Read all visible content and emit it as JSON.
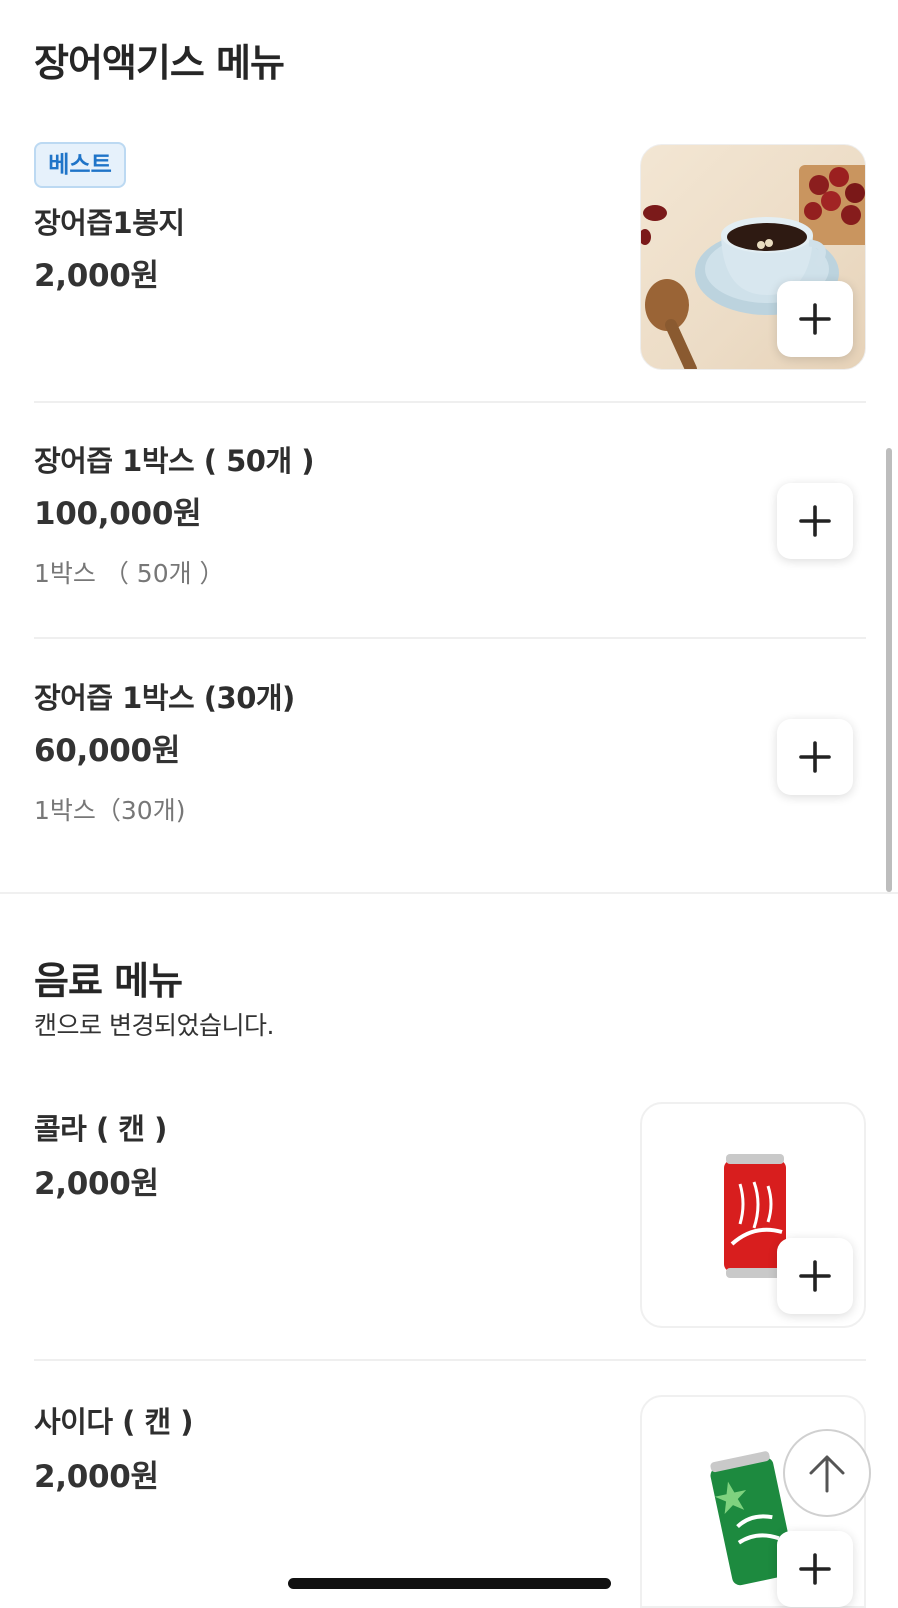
{
  "sections": {
    "extract": {
      "title": "장어액기스 메뉴",
      "items": [
        {
          "badge": "베스트",
          "name": "장어즙1봉지",
          "price": "2,000원"
        },
        {
          "name": "장어즙 1박스 ( 50개 )",
          "price": "100,000원",
          "desc": "1박스 （ 50개 ）"
        },
        {
          "name": "장어즙 1박스 (30개)",
          "price": "60,000원",
          "desc": "1박스（30개)"
        }
      ]
    },
    "drinks": {
      "title": "음료 메뉴",
      "subtitle": "캔으로 변경되었습니다.",
      "items": [
        {
          "name": "콜라 ( 캔 )",
          "price": "2,000원"
        },
        {
          "name": "사이다 ( 캔 )",
          "price": "2,000원"
        }
      ]
    }
  },
  "icons": {
    "add": "plus-icon",
    "scroll_top": "arrow-up-icon"
  },
  "colors": {
    "badge_text": "#1f74c8",
    "badge_bg": "#e6f1fb",
    "text_primary": "#2e2e2e",
    "text_secondary": "#777777"
  }
}
